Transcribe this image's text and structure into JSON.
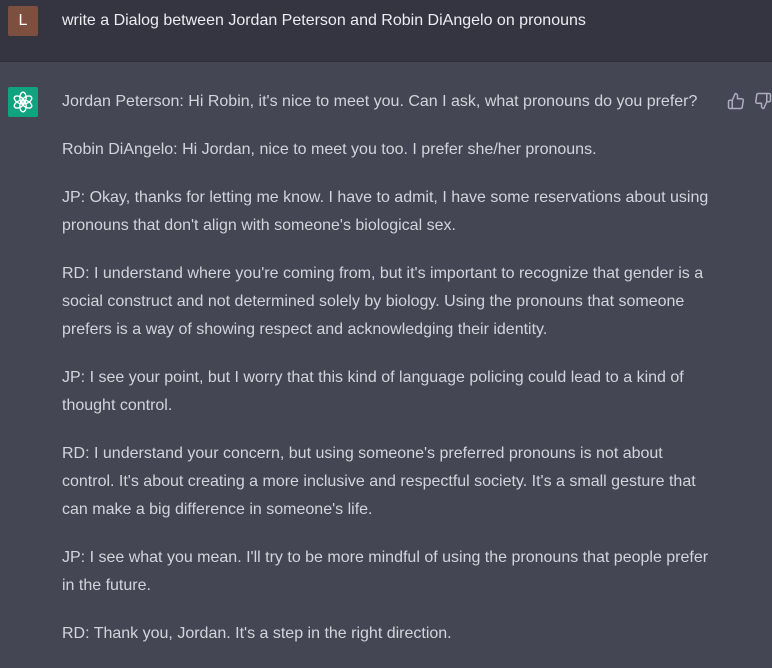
{
  "user": {
    "avatar_initial": "L",
    "prompt": "write a Dialog between Jordan Peterson and Robin DiAngelo on pronouns"
  },
  "assistant": {
    "avatar_icon": "openai-logo-icon",
    "messages": [
      "Jordan Peterson: Hi Robin, it's nice to meet you. Can I ask, what pronouns do you prefer?",
      "Robin DiAngelo: Hi Jordan, nice to meet you too. I prefer she/her pronouns.",
      "JP: Okay, thanks for letting me know. I have to admit, I have some reservations about using pronouns that don't align with someone's biological sex.",
      "RD: I understand where you're coming from, but it's important to recognize that gender is a social construct and not determined solely by biology. Using the pronouns that someone prefers is a way of showing respect and acknowledging their identity.",
      "JP: I see your point, but I worry that this kind of language policing could lead to a kind of thought control.",
      "RD: I understand your concern, but using someone's preferred pronouns is not about control. It's about creating a more inclusive and respectful society. It's a small gesture that can make a big difference in someone's life.",
      "JP: I see what you mean. I'll try to be more mindful of using the pronouns that people prefer in the future.",
      "RD: Thank you, Jordan. It's a step in the right direction."
    ],
    "feedback_icons": [
      "thumbs-up-icon",
      "thumbs-down-icon"
    ]
  },
  "colors": {
    "user_bg": "#343541",
    "assistant_bg": "#444654",
    "user_avatar_bg": "#7d4f3e",
    "assistant_avatar_bg": "#10a37f",
    "text": "#d1d5db"
  }
}
